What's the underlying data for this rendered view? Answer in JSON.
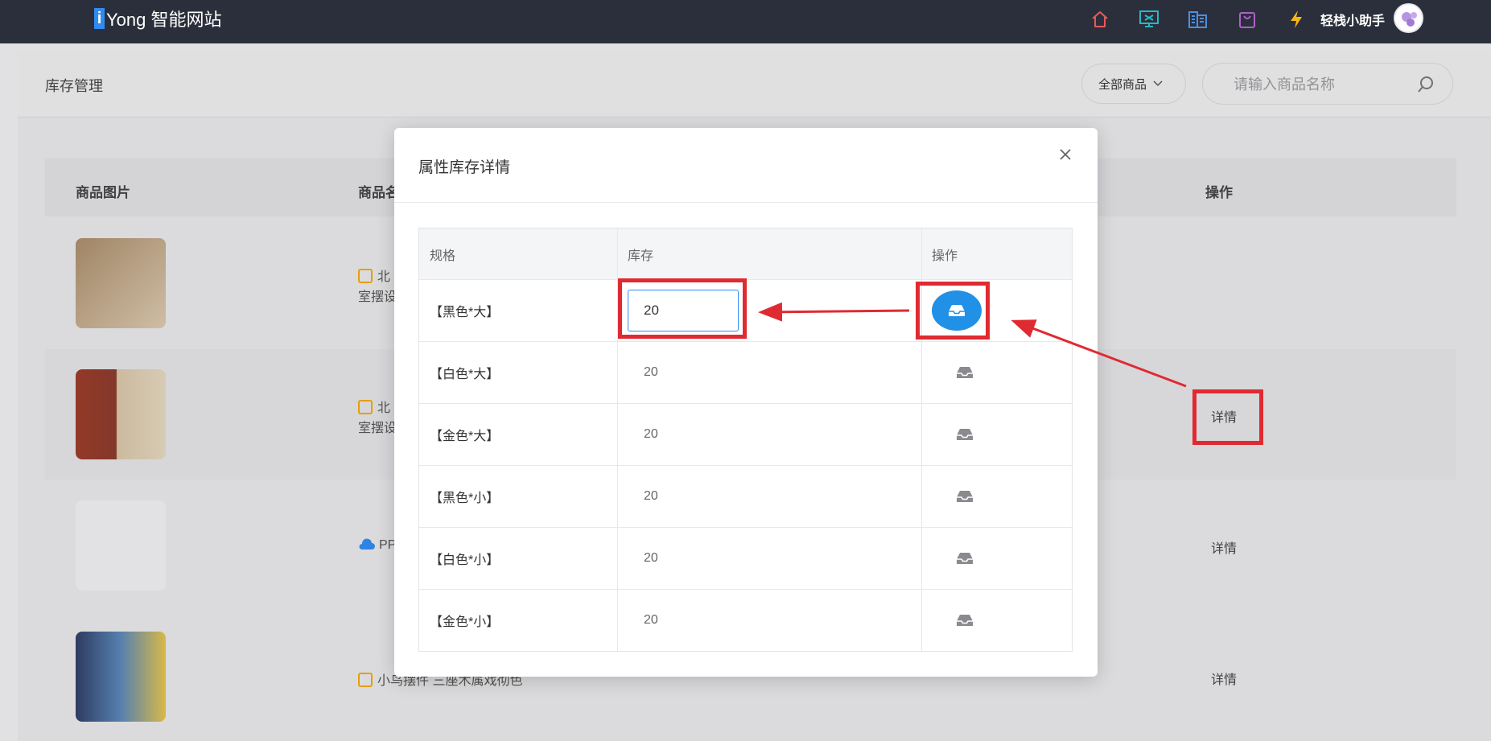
{
  "topbar": {
    "logo_badge": "i",
    "logo_text": "Yong 智能网站",
    "icons": [
      "home-icon",
      "monitor-icon",
      "building-icon",
      "shopping-bag-icon",
      "lightning-icon"
    ],
    "assistant_label": "轻栈小助手"
  },
  "page": {
    "title": "库存管理",
    "filter_label": "全部商品",
    "search_placeholder": "请输入商品名称",
    "columns": {
      "image": "商品图片",
      "name": "商品名",
      "action": "操作"
    },
    "rows": [
      {
        "name_line1": "北",
        "name_line2": "室摆设",
        "detail": ""
      },
      {
        "name_line1": "北",
        "name_line2": "室摆设",
        "detail": "详情"
      },
      {
        "name_line1": "PP",
        "name_line2": "",
        "detail": "详情"
      },
      {
        "name_line1": "小鸟摆件 三座木属戏彻色",
        "name_line2": "",
        "detail": "详情"
      }
    ]
  },
  "modal": {
    "title": "属性库存详情",
    "headers": {
      "spec": "规格",
      "stock": "库存",
      "action": "操作"
    },
    "rows": [
      {
        "spec": "【黑色*大】",
        "stock": "20",
        "editing": true
      },
      {
        "spec": "【白色*大】",
        "stock": "20"
      },
      {
        "spec": "【金色*大】",
        "stock": "20"
      },
      {
        "spec": "【黑色*小】",
        "stock": "20"
      },
      {
        "spec": "【白色*小】",
        "stock": "20"
      },
      {
        "spec": "【金色*小】",
        "stock": "20"
      }
    ]
  },
  "colors": {
    "topbar": "#2b2f3b",
    "primary": "#2091e6",
    "annotation": "#e02a31"
  }
}
